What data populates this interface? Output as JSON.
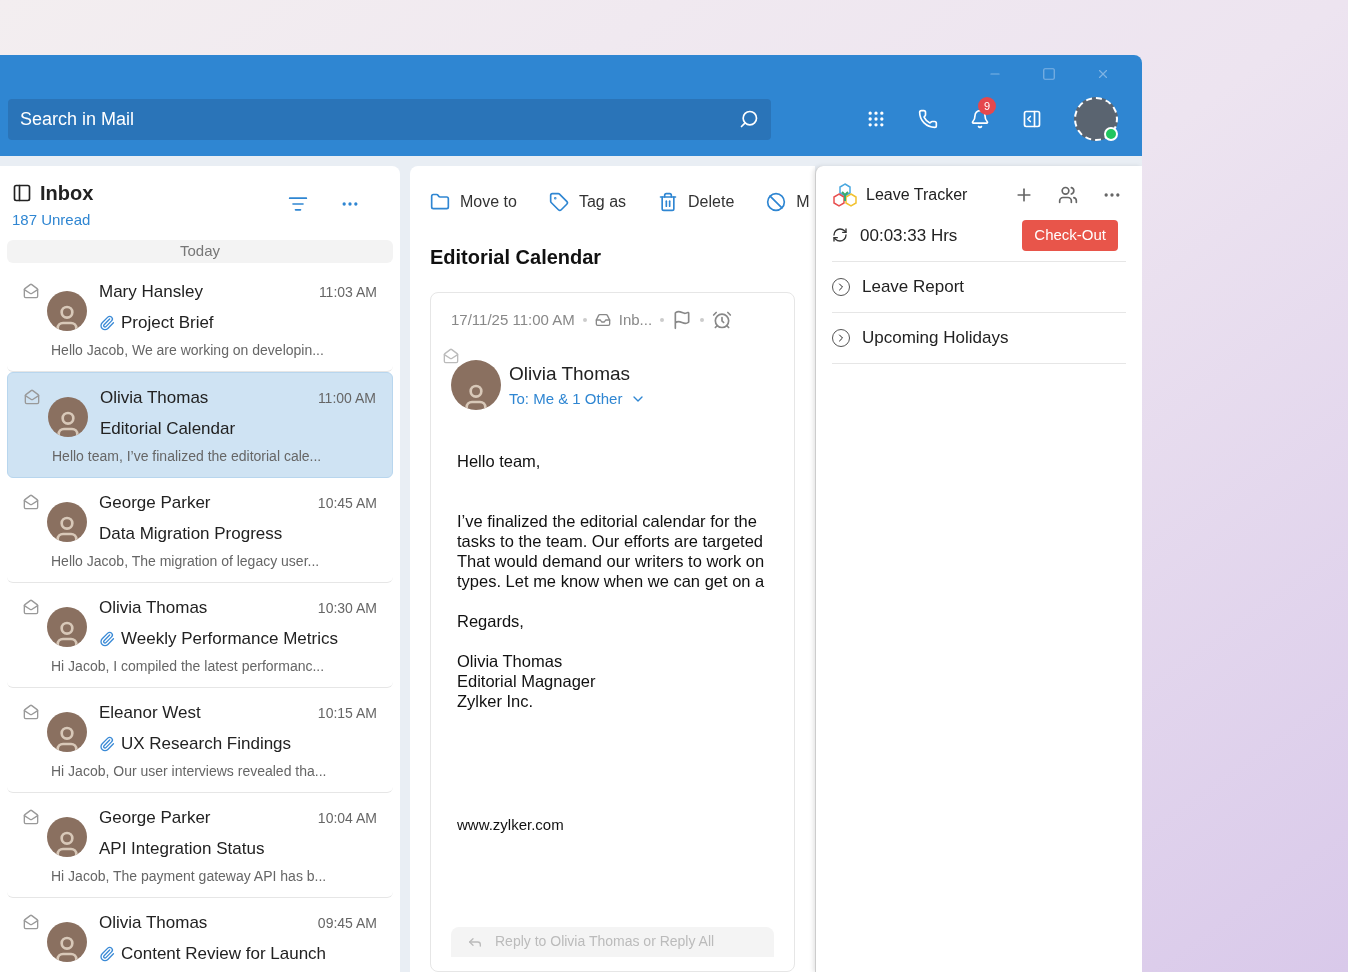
{
  "search": {
    "placeholder": "Search in Mail"
  },
  "header": {
    "notification_count": "9",
    "online": true
  },
  "inbox": {
    "title": "Inbox",
    "unread": "187 Unread",
    "group": "Today",
    "messages": [
      {
        "sender": "Mary Hansley",
        "time": "11:03 AM",
        "subject": "Project Brief",
        "preview": "Hello Jacob, We are working on developin...",
        "attachment": true,
        "selected": false
      },
      {
        "sender": "Olivia Thomas",
        "time": "11:00 AM",
        "subject": "Editorial Calendar",
        "preview": "Hello team, I’ve finalized the editorial cale...",
        "attachment": false,
        "selected": true
      },
      {
        "sender": "George Parker",
        "time": "10:45 AM",
        "subject": "Data Migration Progress",
        "preview": "Hello Jacob, The migration of legacy user...",
        "attachment": false,
        "selected": false
      },
      {
        "sender": "Olivia Thomas",
        "time": "10:30 AM",
        "subject": "Weekly Performance Metrics",
        "preview": "Hi Jacob, I compiled the latest performanc...",
        "attachment": true,
        "selected": false
      },
      {
        "sender": "Eleanor West",
        "time": "10:15 AM",
        "subject": "UX Research Findings",
        "preview": "Hi Jacob, Our user interviews revealed tha...",
        "attachment": true,
        "selected": false
      },
      {
        "sender": "George Parker",
        "time": "10:04 AM",
        "subject": "API Integration Status",
        "preview": "Hi Jacob, The payment gateway API has b...",
        "attachment": false,
        "selected": false
      },
      {
        "sender": "Olivia Thomas",
        "time": "09:45 AM",
        "subject": "Content Review for Launch",
        "attachment": true,
        "selected": false
      }
    ]
  },
  "reader": {
    "toolbar": [
      {
        "kind": "move",
        "label": "Move to"
      },
      {
        "kind": "tag",
        "label": "Tag as"
      },
      {
        "kind": "delete",
        "label": "Delete"
      },
      {
        "kind": "block",
        "label": "M"
      }
    ],
    "subject": "Editorial Calendar",
    "date": "17/11/25 11:00 AM",
    "folder": "Inb...",
    "sender": "Olivia Thomas",
    "recipients": "To: Me & 1 Other",
    "greeting": "Hello team,",
    "body_lines": [
      "I’ve finalized the editorial calendar for the",
      "tasks to the team. Our efforts are targeted",
      "That would demand our writers to work on",
      "types. Let me know when we can get on a"
    ],
    "closing": "Regards,",
    "signature": [
      "Olivia Thomas",
      "Editorial Magnager",
      "Zylker Inc."
    ],
    "website": "www.zylker.com",
    "reply_placeholder": "Reply to Olivia Thomas or Reply All"
  },
  "leave_tracker": {
    "title": "Leave Tracker",
    "timer": "00:03:33 Hrs",
    "check_button": "Check-Out",
    "sections": [
      {
        "label": "Leave Report",
        "expanded": false
      },
      {
        "label": "Upcoming Holidays",
        "expanded": false
      }
    ]
  }
}
